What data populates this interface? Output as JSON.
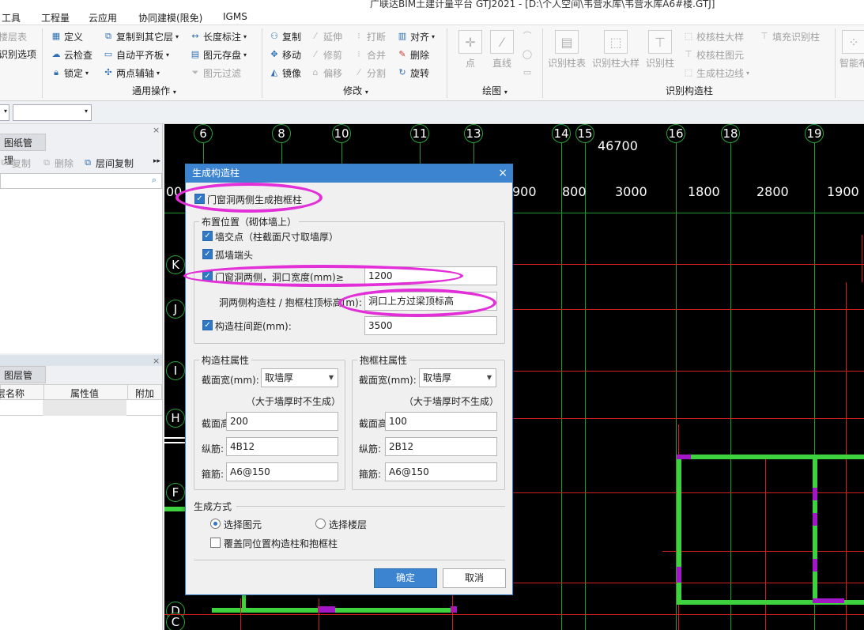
{
  "app": {
    "title": "广联达BIM土建计量平台 GTJ2021 - [D:\\个人空间\\韦营水库\\韦营水库A6#楼.GTJ]",
    "title_visible": "广联达BIM土建计量平台 GTJ2021 - [D:\\个人空间\\韦营水库\\韦营水库A6#楼.GTJ]"
  },
  "menu": [
    "工具",
    "工程量",
    "云应用",
    "协同建模(限免)",
    "IGMS"
  ],
  "ribbon": {
    "common": {
      "items": [
        "楼层表",
        "识别选项",
        "定义",
        "云检查",
        "锁定",
        "复制到其它层",
        "自动平齐板",
        "两点辅轴",
        "长度标注",
        "图元存盘",
        "图元过滤"
      ],
      "group": "通用操作"
    },
    "modify": {
      "items": [
        "复制",
        "延伸",
        "打断",
        "对齐",
        "移动",
        "修剪",
        "合并",
        "删除",
        "镜像",
        "偏移",
        "分割",
        "旋转"
      ],
      "group": "修改"
    },
    "draw": {
      "items": [
        "点",
        "直线"
      ],
      "group": "绘图"
    },
    "recognize": {
      "items": [
        "识别柱表",
        "识别柱大样",
        "识别柱",
        "校核柱大样",
        "校核柱图元",
        "生成柱边线",
        "填充识别柱",
        "智能布"
      ],
      "group": "识别构造柱"
    }
  },
  "leftpanel": {
    "drawing_mgmt": "图纸管理",
    "drawing_tools": [
      "复制",
      "删除",
      "层间复制"
    ],
    "layer_mgmt": "图层管理",
    "layer_cols": [
      "层名称",
      "属性值",
      "附加"
    ]
  },
  "canvas": {
    "axes_top": [
      "6",
      "8",
      "10",
      "11",
      "13",
      "14",
      "15",
      "16",
      "18",
      "19"
    ],
    "axes_left": [
      "K",
      "J",
      "I",
      "H",
      "F",
      "D",
      "C"
    ],
    "total_dim": "46700",
    "dims": [
      "00",
      "900",
      "800",
      "3000",
      "1800",
      "2800",
      "1900"
    ]
  },
  "dialog": {
    "title": "生成构造柱",
    "close": "×",
    "opening_frame_cb": "门窗洞两侧生成抱框柱",
    "placement_group": "布置位置（砌体墙上）",
    "wall_cross": "墙交点（柱截面尺寸取墙厚）",
    "isolated_wall": "孤墙端头",
    "opening_both_sides": "门窗洞两侧，洞口宽度(mm)≥",
    "opening_width": "1200",
    "top_elev_label": "洞两侧构造柱 / 抱框柱顶标高(m):",
    "top_elev_value": "洞口上方过梁顶标高",
    "spacing_label": "构造柱间距(mm):",
    "spacing_value": "3500",
    "col_props": {
      "title": "构造柱属性",
      "width_label": "截面宽(mm):",
      "width_value": "取墙厚",
      "note": "（大于墙厚时不生成）",
      "height_label": "截面高(mm):",
      "height_value": "200",
      "long_bar_label": "纵筋:",
      "long_bar_value": "4B12",
      "stirrup_label": "箍筋:",
      "stirrup_value": "A6@150"
    },
    "frame_props": {
      "title": "抱框柱属性",
      "width_label": "截面宽(mm):",
      "width_value": "取墙厚",
      "note": "（大于墙厚时不生成）",
      "height_label": "截面高(mm):",
      "height_value": "100",
      "long_bar_label": "纵筋:",
      "long_bar_value": "2B12",
      "stirrup_label": "箍筋:",
      "stirrup_value": "A6@150"
    },
    "gen_mode": "生成方式",
    "select_elements": "选择图元",
    "select_floors": "选择楼层",
    "overwrite": "覆盖同位置构造柱和抱框柱",
    "ok": "确定",
    "cancel": "取消"
  },
  "colors": {
    "accent": "#3c84cf",
    "highlight": "#e22fd8",
    "wall": "#3fd23f",
    "axis": "#1f9a2d"
  }
}
